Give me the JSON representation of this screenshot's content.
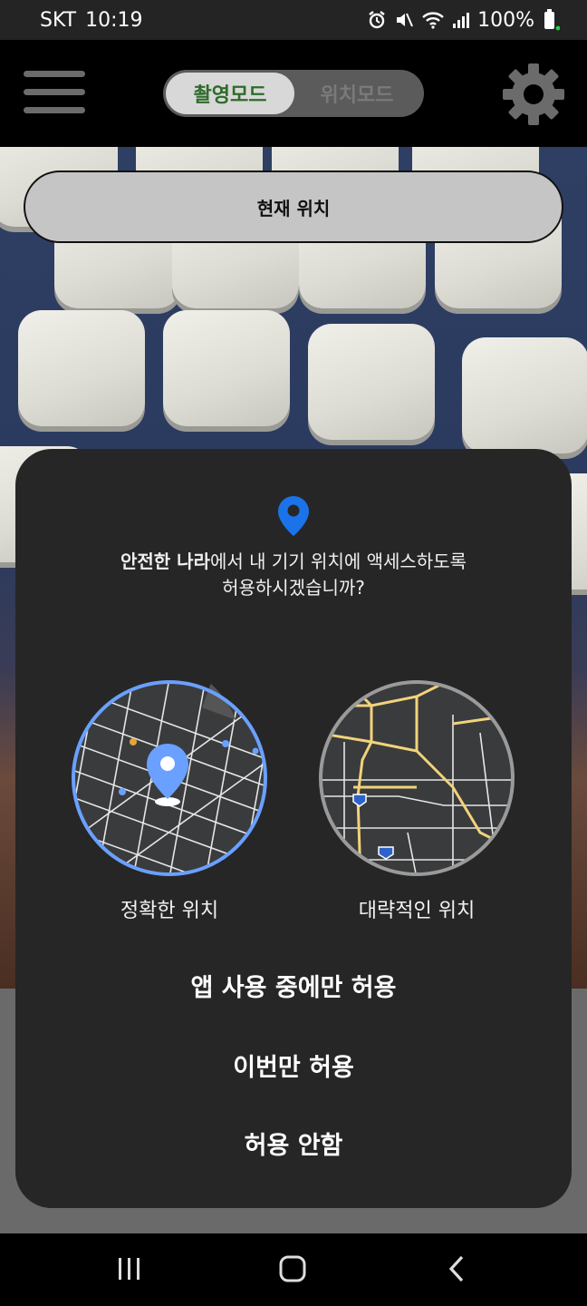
{
  "status_bar": {
    "carrier": "SKT",
    "time": "10:19",
    "battery": "100%",
    "icons": [
      "alarm-icon",
      "mute-icon",
      "wifi-icon",
      "signal-icon",
      "battery-icon"
    ]
  },
  "header": {
    "mode_active": "촬영모드",
    "mode_inactive": "위치모드",
    "icons": [
      "menu-icon",
      "gear-icon"
    ]
  },
  "main": {
    "location_button": "현재 위치"
  },
  "dialog": {
    "app_name": "안전한 나라",
    "message_rest": "에서 내 기기 위치에 액세스하도록",
    "message_line2": "허용하시겠습니까?",
    "precise_label": "정확한 위치",
    "approximate_label": "대략적인 위치",
    "allow_while_using": "앱 사용 중에만 허용",
    "allow_once": "이번만 허용",
    "deny": "허용 안함"
  },
  "colors": {
    "accent": "#1a73e8",
    "dialog_bg": "#262626",
    "mode_active_text": "#2f6b2a"
  }
}
